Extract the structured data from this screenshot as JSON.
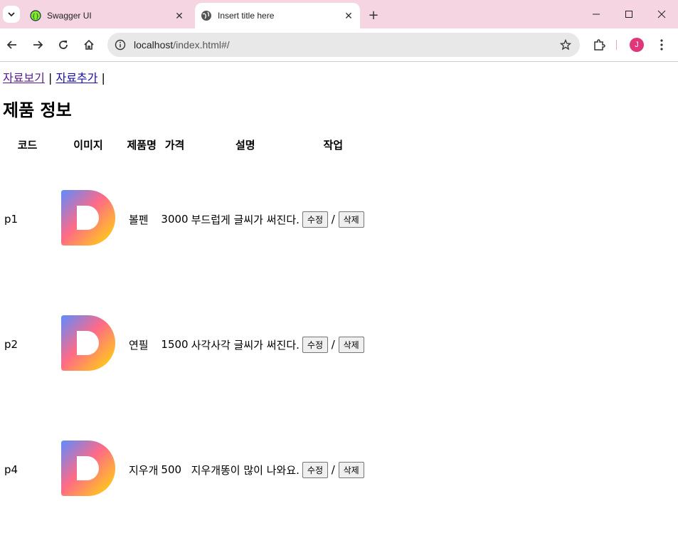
{
  "browser": {
    "tabs": [
      {
        "title": "Swagger UI",
        "active": false,
        "icon": "swagger-icon"
      },
      {
        "title": "Insert title here",
        "active": true,
        "icon": "globe-icon"
      }
    ],
    "url_host": "localhost",
    "url_path": "/index.html#/",
    "profile_initial": "J",
    "colors": {
      "titlebar": "#f6d5e3",
      "avatar": "#e0367a"
    }
  },
  "page": {
    "nav": {
      "view": "자료보기",
      "add": "자료추가",
      "sep": "|"
    },
    "title": "제품 정보",
    "columns": [
      "코드",
      "이미지",
      "제품명",
      "가격",
      "설명",
      "작업"
    ],
    "rows": [
      {
        "code": "p1",
        "name": "볼펜",
        "price": "3000",
        "desc": "부드럽게 글씨가 써진다."
      },
      {
        "code": "p2",
        "name": "연필",
        "price": "1500",
        "desc": "사각사각 글씨가 써진다."
      },
      {
        "code": "p4",
        "name": "지우개",
        "price": "500",
        "desc": "지우개똥이 많이 나와요."
      }
    ],
    "edit_label": "수정",
    "delete_label": "삭제",
    "action_sep": "/"
  }
}
